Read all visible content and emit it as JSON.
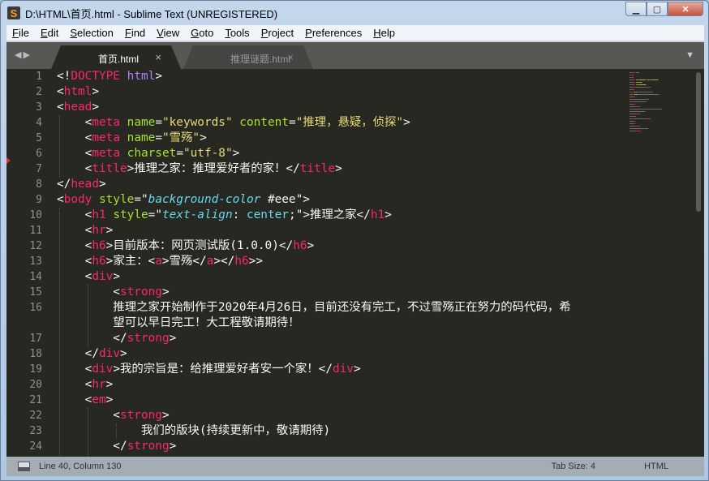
{
  "window": {
    "title": "D:\\HTML\\首页.html - Sublime Text (UNREGISTERED)",
    "app_icon": "sublime-s-logo",
    "logo_letter": "S"
  },
  "menu": [
    "File",
    "Edit",
    "Selection",
    "Find",
    "View",
    "Goto",
    "Tools",
    "Project",
    "Preferences",
    "Help"
  ],
  "tabs": [
    {
      "label": "首页.html",
      "active": true
    },
    {
      "label": "推理谜题.html",
      "active": false
    }
  ],
  "colors": {
    "background": "#272822",
    "tag": "#f92672",
    "attribute": "#a6e22e",
    "string": "#e6db74",
    "text": "#f8f8f2",
    "css": "#66d9ef",
    "keyword": "#ae81ff"
  },
  "lines": [
    {
      "n": "1",
      "tokens": [
        [
          "p",
          "<!"
        ],
        [
          "tag",
          "DOCTYPE"
        ],
        [
          "p",
          " "
        ],
        [
          "kw",
          "html"
        ],
        [
          "p",
          ">"
        ]
      ]
    },
    {
      "n": "2",
      "tokens": [
        [
          "p",
          "<"
        ],
        [
          "tag",
          "html"
        ],
        [
          "p",
          ">"
        ]
      ]
    },
    {
      "n": "3",
      "tokens": [
        [
          "p",
          "<"
        ],
        [
          "tag",
          "head"
        ],
        [
          "p",
          ">"
        ]
      ]
    },
    {
      "n": "4",
      "tokens": [
        [
          "p",
          "    <"
        ],
        [
          "tag",
          "meta"
        ],
        [
          "p",
          " "
        ],
        [
          "attr",
          "name"
        ],
        [
          "p",
          "="
        ],
        [
          "str",
          "\"keywords\""
        ],
        [
          "p",
          " "
        ],
        [
          "attr",
          "content"
        ],
        [
          "p",
          "="
        ],
        [
          "str",
          "\"推理，悬疑，侦探\""
        ],
        [
          "p",
          ">"
        ]
      ]
    },
    {
      "n": "5",
      "tokens": [
        [
          "p",
          "    <"
        ],
        [
          "tag",
          "meta"
        ],
        [
          "p",
          " "
        ],
        [
          "attr",
          "name"
        ],
        [
          "p",
          "="
        ],
        [
          "str",
          "\"雪殇\""
        ],
        [
          "p",
          ">"
        ]
      ]
    },
    {
      "n": "6",
      "tokens": [
        [
          "p",
          "    <"
        ],
        [
          "tag",
          "meta"
        ],
        [
          "p",
          " "
        ],
        [
          "attr",
          "charset"
        ],
        [
          "p",
          "="
        ],
        [
          "str",
          "\"utf-8\""
        ],
        [
          "p",
          ">"
        ]
      ]
    },
    {
      "n": "7",
      "tokens": [
        [
          "p",
          "    <"
        ],
        [
          "tag",
          "title"
        ],
        [
          "p",
          ">"
        ],
        [
          "txt",
          "推理之家：推理爱好者的家！"
        ],
        [
          "p",
          "</"
        ],
        [
          "tag",
          "title"
        ],
        [
          "p",
          ">"
        ]
      ]
    },
    {
      "n": "8",
      "tokens": [
        [
          "p",
          "</"
        ],
        [
          "tag",
          "head"
        ],
        [
          "p",
          ">"
        ]
      ]
    },
    {
      "n": "9",
      "tokens": [
        [
          "p",
          "<"
        ],
        [
          "tag",
          "body"
        ],
        [
          "p",
          " "
        ],
        [
          "attr",
          "style"
        ],
        [
          "p",
          "=\""
        ],
        [
          "css",
          "background-color"
        ],
        [
          "p",
          " #eee\">"
        ]
      ]
    },
    {
      "n": "10",
      "tokens": [
        [
          "p",
          "    <"
        ],
        [
          "tag",
          "h1"
        ],
        [
          "p",
          " "
        ],
        [
          "attr",
          "style"
        ],
        [
          "p",
          "=\""
        ],
        [
          "css",
          "text-align"
        ],
        [
          "p",
          ": "
        ],
        [
          "val",
          "center"
        ],
        [
          "p",
          ";\">"
        ],
        [
          "txt",
          "推理之家"
        ],
        [
          "p",
          "</"
        ],
        [
          "tag",
          "h1"
        ],
        [
          "p",
          ">"
        ]
      ]
    },
    {
      "n": "11",
      "tokens": [
        [
          "p",
          "    <"
        ],
        [
          "tag",
          "hr"
        ],
        [
          "p",
          ">"
        ]
      ]
    },
    {
      "n": "12",
      "tokens": [
        [
          "p",
          "    <"
        ],
        [
          "tag",
          "h6"
        ],
        [
          "p",
          ">"
        ],
        [
          "txt",
          "目前版本：网页测试版(1.0.0)"
        ],
        [
          "p",
          "</"
        ],
        [
          "tag",
          "h6"
        ],
        [
          "p",
          ">"
        ]
      ]
    },
    {
      "n": "13",
      "tokens": [
        [
          "p",
          "    <"
        ],
        [
          "tag",
          "h6"
        ],
        [
          "p",
          ">"
        ],
        [
          "txt",
          "家主："
        ],
        [
          "p",
          "<"
        ],
        [
          "tag",
          "a"
        ],
        [
          "p",
          ">"
        ],
        [
          "txt",
          "雪殇"
        ],
        [
          "p",
          "</"
        ],
        [
          "tag",
          "a"
        ],
        [
          "p",
          "></"
        ],
        [
          "tag",
          "h6"
        ],
        [
          "p",
          ">>"
        ]
      ]
    },
    {
      "n": "14",
      "tokens": [
        [
          "p",
          "    <"
        ],
        [
          "tag",
          "div"
        ],
        [
          "p",
          ">"
        ]
      ]
    },
    {
      "n": "15",
      "tokens": [
        [
          "p",
          "        <"
        ],
        [
          "tag",
          "strong"
        ],
        [
          "p",
          ">"
        ]
      ]
    },
    {
      "n": "16",
      "tokens": [
        [
          "txt",
          "        推理之家开始制作于2020年4月26日，目前还没有完工，不过雪殇正在努力的码代码，希"
        ]
      ]
    },
    {
      "n": "",
      "tokens": [
        [
          "txt",
          "        望可以早日完工！大工程敬请期待！"
        ]
      ]
    },
    {
      "n": "17",
      "tokens": [
        [
          "p",
          "        </"
        ],
        [
          "tag",
          "strong"
        ],
        [
          "p",
          ">"
        ]
      ]
    },
    {
      "n": "18",
      "tokens": [
        [
          "p",
          "    </"
        ],
        [
          "tag",
          "div"
        ],
        [
          "p",
          ">"
        ]
      ]
    },
    {
      "n": "19",
      "tokens": [
        [
          "p",
          "    <"
        ],
        [
          "tag",
          "div"
        ],
        [
          "p",
          ">"
        ],
        [
          "txt",
          "我的宗旨是：给推理爱好者安一个家！"
        ],
        [
          "p",
          "</"
        ],
        [
          "tag",
          "div"
        ],
        [
          "p",
          ">"
        ]
      ]
    },
    {
      "n": "20",
      "tokens": [
        [
          "p",
          "    <"
        ],
        [
          "tag",
          "hr"
        ],
        [
          "p",
          ">"
        ]
      ]
    },
    {
      "n": "21",
      "tokens": [
        [
          "p",
          "    <"
        ],
        [
          "tag",
          "em"
        ],
        [
          "p",
          ">"
        ]
      ]
    },
    {
      "n": "22",
      "tokens": [
        [
          "p",
          "        <"
        ],
        [
          "tag",
          "strong"
        ],
        [
          "p",
          ">"
        ]
      ]
    },
    {
      "n": "23",
      "tokens": [
        [
          "txt",
          "            我们的版块(持续更新中，敬请期待)"
        ]
      ]
    },
    {
      "n": "24",
      "tokens": [
        [
          "p",
          "        </"
        ],
        [
          "tag",
          "strong"
        ],
        [
          "p",
          ">"
        ]
      ]
    }
  ],
  "status": {
    "position": "Line 40, Column 130",
    "tab_size": "Tab Size: 4",
    "syntax": "HTML"
  }
}
